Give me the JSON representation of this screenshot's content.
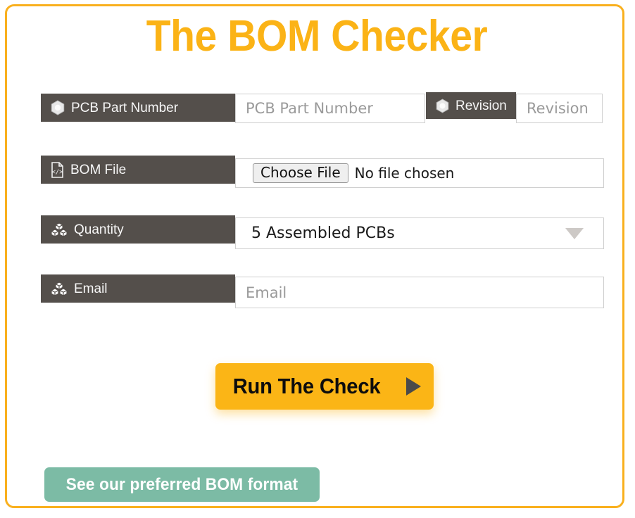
{
  "page": {
    "title": "The BOM Checker",
    "border_color": "#F9B01E",
    "title_color": "#FBB316"
  },
  "form": {
    "label_bg": "#544F4B",
    "rows": [
      {
        "id": "pcb",
        "label": "PCB Part Number",
        "icon": "hexagon-icon",
        "placeholder": "PCB Part Number",
        "value": ""
      },
      {
        "id": "revision",
        "label": "Revision",
        "icon": "hexagon-icon",
        "placeholder": "Revision",
        "value": ""
      },
      {
        "id": "bom_file",
        "label": "BOM File",
        "icon": "file-code-icon",
        "choose_file_label": "Choose File",
        "file_status": "No file chosen"
      },
      {
        "id": "quantity",
        "label": "Quantity",
        "icon": "stacked-cubes-icon",
        "selected": "5 Assembled PCBs"
      },
      {
        "id": "email",
        "label": "Email",
        "icon": "stacked-cubes-icon",
        "placeholder": "Email",
        "value": ""
      }
    ]
  },
  "actions": {
    "run_check": {
      "label": "Run The Check",
      "icon": "play-triangle-icon",
      "color": "#FBB516"
    },
    "bom_format": {
      "label": "See our preferred BOM format",
      "color": "#7CBBA5"
    }
  }
}
